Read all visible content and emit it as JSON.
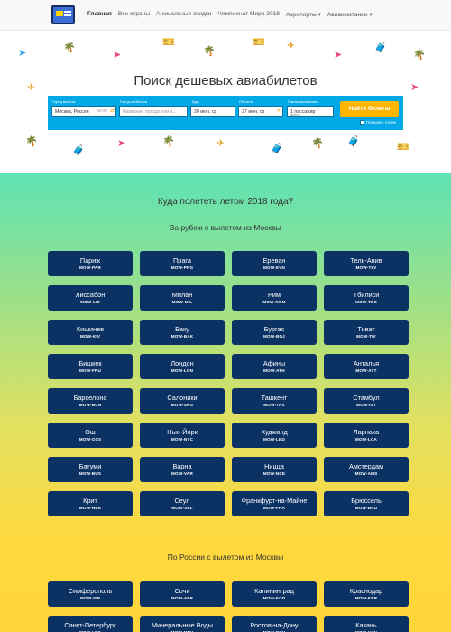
{
  "nav": {
    "items": [
      "Главная",
      "Все страны",
      "Аномальные скидки",
      "Чемпионат Мира 2018",
      "Аэропорты ▾",
      "Авиакомпании ▾"
    ]
  },
  "hero": {
    "title": "Поиск дешевых авиабилетов",
    "from": {
      "label": "Город вылета",
      "value": "Москва, Россия",
      "code": "MOW"
    },
    "to": {
      "label": "Город прибытия",
      "placeholder": "Название города или а..."
    },
    "depart": {
      "label": "Туда",
      "value": "20 июн, ср"
    },
    "return": {
      "label": "Обратно",
      "value": "27 июн, ср"
    },
    "pax": {
      "label": "Пассажиров/класс",
      "value": "1 пассажир",
      "sub": "эконом"
    },
    "button": "Найти билеты",
    "hotels": "Показать отели"
  },
  "main": {
    "title": "Куда полететь летом 2018 года?",
    "abroad_title": "За рубеж с вылетом из Москвы",
    "abroad": [
      {
        "city": "Париж",
        "code": "MOW-PAR"
      },
      {
        "city": "Прага",
        "code": "MOW-PRG"
      },
      {
        "city": "Ереван",
        "code": "MOW-EVN"
      },
      {
        "city": "Тель-Авив",
        "code": "MOW-TLV"
      },
      {
        "city": "Лиссабон",
        "code": "MOW-LIS"
      },
      {
        "city": "Милан",
        "code": "MOW-MIL"
      },
      {
        "city": "Рим",
        "code": "MOW-ROM"
      },
      {
        "city": "Тбилиси",
        "code": "MOW-TBS"
      },
      {
        "city": "Кишинев",
        "code": "MOW-KIV"
      },
      {
        "city": "Баку",
        "code": "MOW-BAK"
      },
      {
        "city": "Бургас",
        "code": "MOW-BOJ"
      },
      {
        "city": "Тиват",
        "code": "MOW-TIV"
      },
      {
        "city": "Бишкек",
        "code": "MOW-FRU"
      },
      {
        "city": "Лондон",
        "code": "MOW-LON"
      },
      {
        "city": "Афины",
        "code": "MOW-ATH"
      },
      {
        "city": "Анталья",
        "code": "MOW-AYT"
      },
      {
        "city": "Барселона",
        "code": "MOW-BCN"
      },
      {
        "city": "Салоники",
        "code": "MOW-SKG"
      },
      {
        "city": "Ташкент",
        "code": "MOW-TAS"
      },
      {
        "city": "Стамбул",
        "code": "MOW-IST"
      },
      {
        "city": "Ош",
        "code": "MOW-OSS"
      },
      {
        "city": "Нью-Йорк",
        "code": "MOW-NYC"
      },
      {
        "city": "Худжанд",
        "code": "MOW-LBD"
      },
      {
        "city": "Ларнака",
        "code": "MOW-LCA"
      },
      {
        "city": "Батуми",
        "code": "MOW-BUS"
      },
      {
        "city": "Варна",
        "code": "MOW-VAR"
      },
      {
        "city": "Ницца",
        "code": "MOW-NCE"
      },
      {
        "city": "Амстердам",
        "code": "MOW-AMS"
      },
      {
        "city": "Крит",
        "code": "MOW-HER"
      },
      {
        "city": "Сеул",
        "code": "MOW-SEL"
      },
      {
        "city": "Франкфурт-на-Майне",
        "code": "MOW-FRA"
      },
      {
        "city": "Брюссель",
        "code": "MOW-BRU"
      }
    ],
    "russia_title": "По России с вылетом из Москвы",
    "russia": [
      {
        "city": "Симферополь",
        "code": "MOW-SIP"
      },
      {
        "city": "Сочи",
        "code": "MOW-AER"
      },
      {
        "city": "Калининград",
        "code": "MOW-KGD"
      },
      {
        "city": "Краснодар",
        "code": "MOW-KRR"
      },
      {
        "city": "Санкт-Петербург",
        "code": "MOW-LED"
      },
      {
        "city": "Минеральные Воды",
        "code": "MOW-MRV"
      },
      {
        "city": "Ростов-на-Дону",
        "code": "MOW-ROV"
      },
      {
        "city": "Казань",
        "code": "MOW-KZN"
      }
    ]
  },
  "colors": {
    "card": "#0c3264",
    "search": "#03a9e6",
    "button": "#ffb400"
  }
}
